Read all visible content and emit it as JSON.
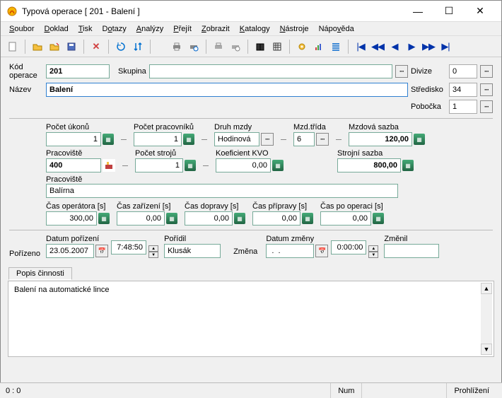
{
  "window": {
    "title": "Typová operace [ 201 - Balení ]"
  },
  "menu": [
    "Soubor",
    "Doklad",
    "Tisk",
    "Dotazy",
    "Analýzy",
    "Přejít",
    "Zobrazit",
    "Katalogy",
    "Nástroje",
    "Nápověda"
  ],
  "header": {
    "kod_label": "Kód operace",
    "kod": "201",
    "skupina_label": "Skupina",
    "skupina": "",
    "divize_label": "Divize",
    "divize": "0",
    "nazev_label": "Název",
    "nazev": "Balení",
    "stredisko_label": "Středisko",
    "stredisko": "34",
    "pobocka_label": "Pobočka",
    "pobocka": "1"
  },
  "f": {
    "pocet_ukonu_label": "Počet úkonů",
    "pocet_ukonu": "1",
    "pocet_prac_label": "Počet pracovníků",
    "pocet_prac": "1",
    "druh_mzdy_label": "Druh mzdy",
    "druh_mzdy": "Hodinová",
    "mzd_trida_label": "Mzd.třída",
    "mzd_trida": "6",
    "mzdova_sazba_label": "Mzdová sazba",
    "mzdova_sazba": "120,00",
    "pracoviste_label": "Pracoviště",
    "pracoviste_code": "400",
    "pocet_stroju_label": "Počet strojů",
    "pocet_stroju": "1",
    "koef_label": "Koeficient KVO",
    "koef": "0,00",
    "strojni_sazba_label": "Strojní sazba",
    "strojni_sazba": "800,00",
    "pracoviste_name_label": "Pracoviště",
    "pracoviste_name": "Balírna",
    "cas_op_label": "Čas operátora [s]",
    "cas_op": "300,00",
    "cas_zar_label": "Čas zařízení [s]",
    "cas_zar": "0,00",
    "cas_dop_label": "Čas dopravy [s]",
    "cas_dop": "0,00",
    "cas_pri_label": "Čas přípravy [s]",
    "cas_pri": "0,00",
    "cas_po_label": "Čas po operaci [s]",
    "cas_po": "0,00"
  },
  "audit": {
    "porizeno_label": "Pořízeno",
    "datum_porizeni_label": "Datum pořízení",
    "datum_porizeni": "23.05.2007",
    "cas_porizeni": "7:48:50",
    "poridil_label": "Pořídil",
    "poridil": "Klusák",
    "zmena_label": "Změna",
    "datum_zmeny_label": "Datum změny",
    "datum_zmeny": " .  .    ",
    "cas_zmeny": "0:00:00",
    "zmenil_label": "Změnil",
    "zmenil": ""
  },
  "tab": {
    "title": "Popis činnosti",
    "content": "Balení na automatické lince"
  },
  "status": {
    "left": "0 :    0",
    "num": "Num",
    "mode": "Prohlížení"
  }
}
